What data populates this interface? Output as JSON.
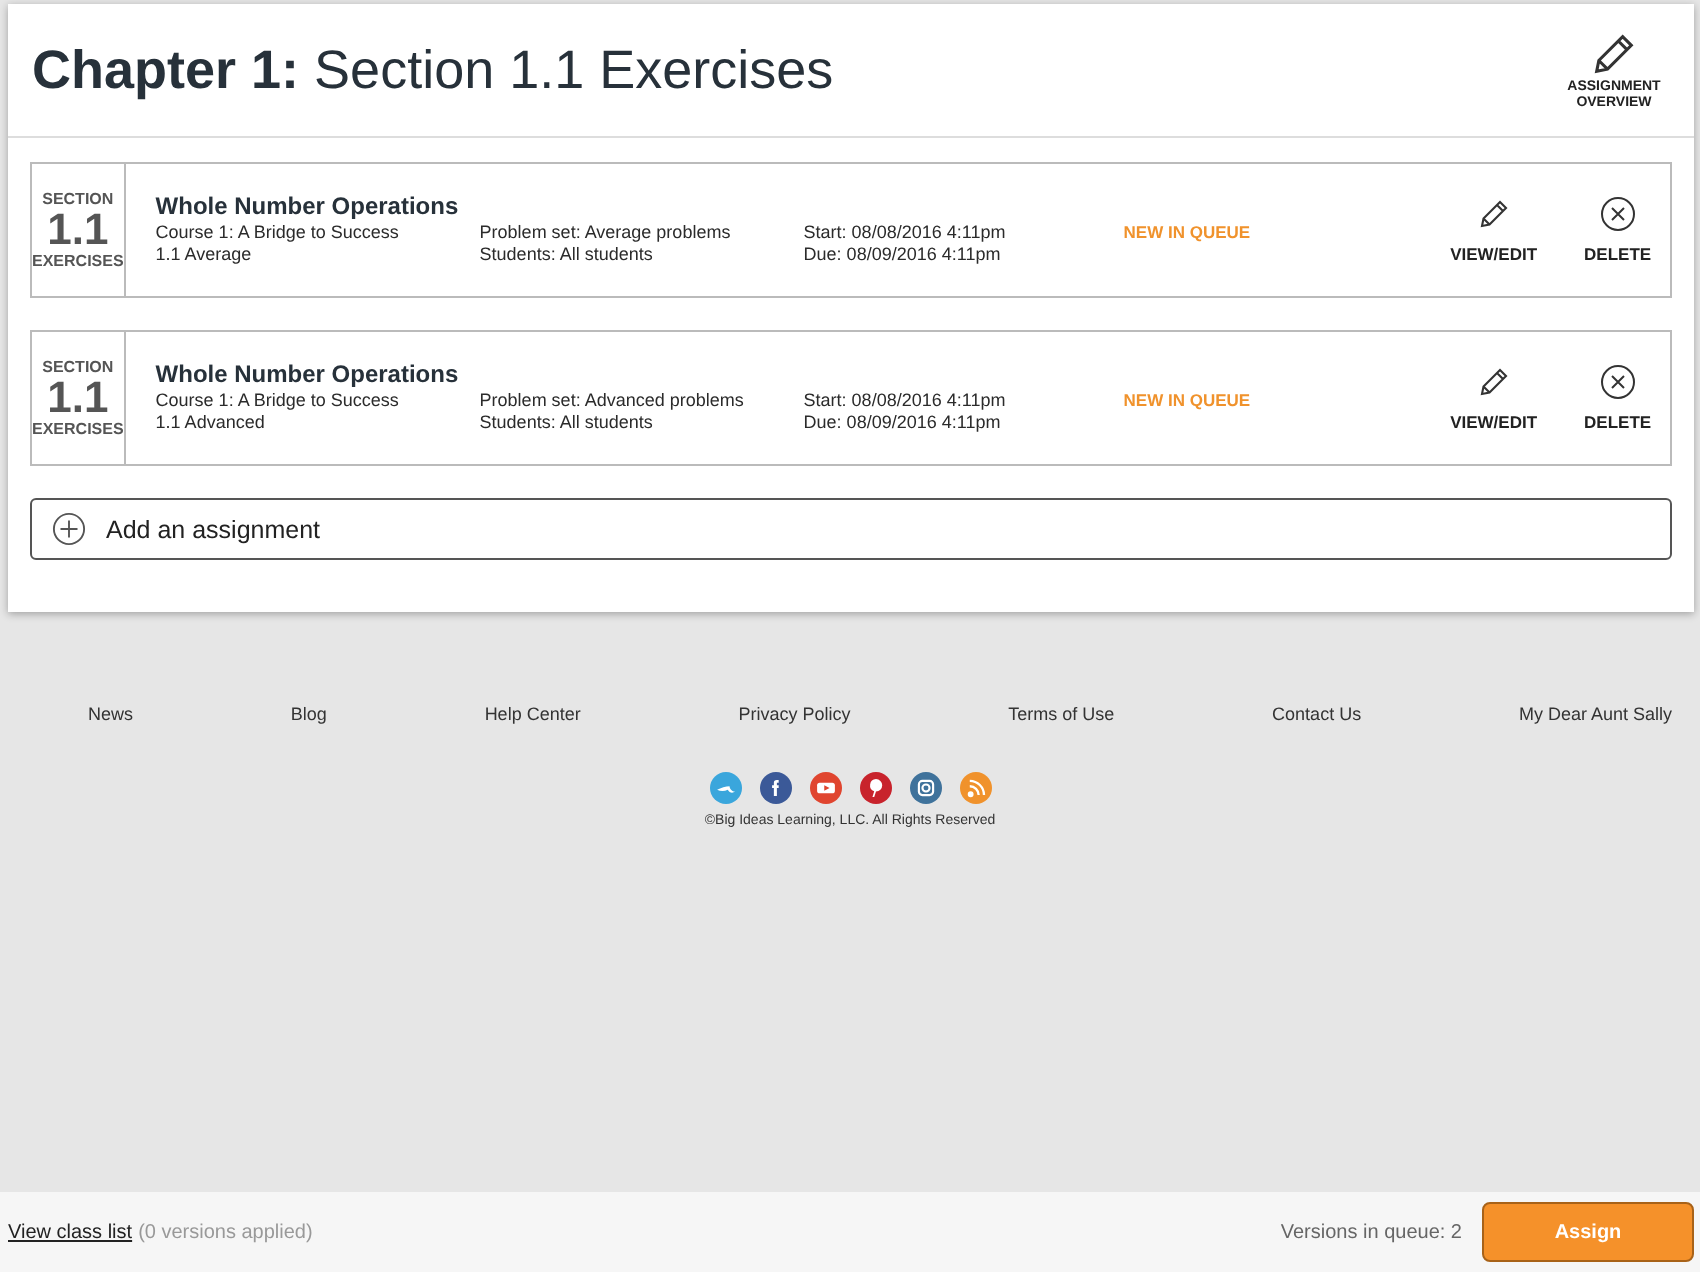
{
  "header": {
    "title_bold": "Chapter 1:",
    "title_rest": "Section 1.1 Exercises",
    "overview_label": "ASSIGNMENT OVERVIEW"
  },
  "assignments": [
    {
      "badge_top": "SECTION",
      "badge_number": "1.1",
      "badge_bottom": "EXERCISES",
      "title": "Whole Number Operations",
      "course": "Course 1: A Bridge to Success",
      "level_name": "1.1 Average",
      "problem_set": "Problem set: Average problems",
      "students": "Students: All students",
      "start": "Start: 08/08/2016 4:11pm",
      "due": "Due: 08/09/2016 4:11pm",
      "status": "NEW IN QUEUE",
      "edit_label": "VIEW/EDIT",
      "delete_label": "DELETE"
    },
    {
      "badge_top": "SECTION",
      "badge_number": "1.1",
      "badge_bottom": "EXERCISES",
      "title": "Whole Number Operations",
      "course": "Course 1: A Bridge to Success",
      "level_name": "1.1 Advanced",
      "problem_set": "Problem set: Advanced problems",
      "students": "Students: All students",
      "start": "Start: 08/08/2016 4:11pm",
      "due": "Due: 08/09/2016 4:11pm",
      "status": "NEW IN QUEUE",
      "edit_label": "VIEW/EDIT",
      "delete_label": "DELETE"
    }
  ],
  "add_assignment": {
    "label": "Add an assignment"
  },
  "footer": {
    "links": [
      "News",
      "Blog",
      "Help Center",
      "Privacy Policy",
      "Terms of Use",
      "Contact Us",
      "My Dear Aunt Sally"
    ],
    "social": [
      {
        "kind": "bird",
        "color": "#3aa6dc"
      },
      {
        "kind": "f",
        "color": "#3b5998"
      },
      {
        "kind": "play",
        "color": "#e0452f"
      },
      {
        "kind": "pin",
        "color": "#c8232c"
      },
      {
        "kind": "camera",
        "color": "#3f729b"
      },
      {
        "kind": "rss",
        "color": "#f0922c"
      }
    ],
    "copyright": "©Big Ideas Learning, LLC. All Rights Reserved"
  },
  "bottom_bar": {
    "class_link": "View class list",
    "versions_applied": "(0 versions applied)",
    "queue": "Versions in queue: 2",
    "assign": "Assign"
  }
}
